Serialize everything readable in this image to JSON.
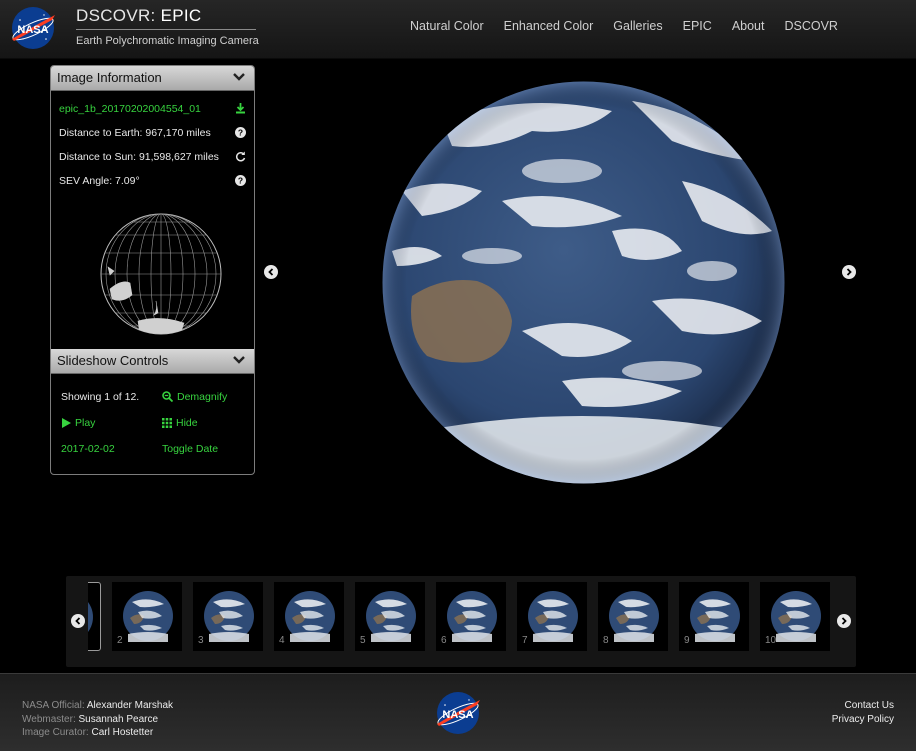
{
  "header": {
    "title_prefix": "DSCOVR: ",
    "title_strong": "EPIC",
    "subtitle": "Earth Polychromatic Imaging Camera",
    "nav": [
      "Natural Color",
      "Enhanced Color",
      "Galleries",
      "EPIC",
      "About",
      "DSCOVR"
    ]
  },
  "image_info": {
    "heading": "Image Information",
    "filename": "epic_1b_20170202004554_01",
    "distance_earth": "Distance to Earth: 967,170 miles",
    "distance_sun": "Distance to Sun: 91,598,627 miles",
    "sev_angle": "SEV Angle: 7.09°"
  },
  "slideshow": {
    "heading": "Slideshow Controls",
    "showing": "Showing 1 of 12.",
    "demagnify": "Demagnify",
    "play": "Play",
    "hide": "Hide",
    "date": "2017-02-02",
    "toggle_date": "Toggle Date"
  },
  "thumbnails": [
    "",
    "2",
    "3",
    "4",
    "5",
    "6",
    "7",
    "8",
    "9",
    "10"
  ],
  "footer": {
    "official_label": "NASA Official:",
    "official_name": "Alexander Marshak",
    "webmaster_label": "Webmaster:",
    "webmaster_name": "Susannah Pearce",
    "curator_label": "Image Curator:",
    "curator_name": "Carl Hostetter",
    "contact": "Contact Us",
    "privacy": "Privacy Policy"
  },
  "logo_text": "NASA",
  "colors": {
    "accent_green": "#37d33f",
    "nasa_blue": "#0b3d91",
    "nasa_red": "#fc3d21"
  },
  "icons": [
    "download-icon",
    "question-icon",
    "refresh-icon",
    "chevron-down-icon",
    "zoom-icon",
    "play-icon",
    "grid-icon",
    "arrow-left-icon",
    "arrow-right-icon"
  ]
}
